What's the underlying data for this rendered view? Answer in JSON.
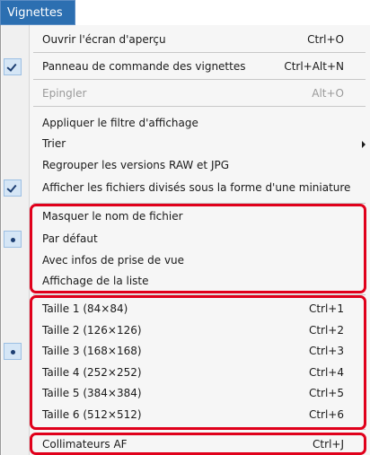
{
  "menu": {
    "title": "Vignettes",
    "items": [
      {
        "label": "Ouvrir l'écran d'aperçu",
        "shortcut": "Ctrl+O",
        "state": "none",
        "enabled": true
      },
      {
        "label": "Panneau de commande des vignettes",
        "shortcut": "Ctrl+Alt+N",
        "state": "checked",
        "enabled": true
      },
      {
        "label": "Epingler",
        "shortcut": "Alt+O",
        "state": "none",
        "enabled": false
      },
      {
        "label": "Appliquer le filtre d'affichage",
        "shortcut": "",
        "state": "none",
        "enabled": true
      },
      {
        "label": "Trier",
        "shortcut": "",
        "state": "none",
        "enabled": true,
        "submenu": true
      },
      {
        "label": "Regrouper les versions RAW et JPG",
        "shortcut": "",
        "state": "none",
        "enabled": true
      },
      {
        "label": "Afficher les fichiers divisés sous la forme d'une miniature",
        "shortcut": "",
        "state": "checked",
        "enabled": true
      },
      {
        "label": "Masquer le nom de fichier",
        "shortcut": "",
        "state": "none",
        "enabled": true
      },
      {
        "label": "Par défaut",
        "shortcut": "",
        "state": "radio",
        "enabled": true
      },
      {
        "label": "Avec infos de prise de vue",
        "shortcut": "",
        "state": "none",
        "enabled": true
      },
      {
        "label": "Affichage de la liste",
        "shortcut": "",
        "state": "none",
        "enabled": true
      },
      {
        "label": "Taille 1 (84×84)",
        "shortcut": "Ctrl+1",
        "state": "none",
        "enabled": true
      },
      {
        "label": "Taille 2 (126×126)",
        "shortcut": "Ctrl+2",
        "state": "none",
        "enabled": true
      },
      {
        "label": "Taille 3 (168×168)",
        "shortcut": "Ctrl+3",
        "state": "radio",
        "enabled": true
      },
      {
        "label": "Taille 4 (252×252)",
        "shortcut": "Ctrl+4",
        "state": "none",
        "enabled": true
      },
      {
        "label": "Taille 5 (384×384)",
        "shortcut": "Ctrl+5",
        "state": "none",
        "enabled": true
      },
      {
        "label": "Taille 6 (512×512)",
        "shortcut": "Ctrl+6",
        "state": "none",
        "enabled": true
      },
      {
        "label": "Collimateurs AF",
        "shortcut": "Ctrl+J",
        "state": "none",
        "enabled": true
      }
    ]
  },
  "colors": {
    "menu_title_bg": "#2c6fb1",
    "highlight_outline": "#e0001b",
    "disabled_text": "#9a9a9a"
  },
  "icons": {
    "checked": "checkmark-icon",
    "radio": "radio-dot-icon",
    "submenu": "submenu-arrow-icon"
  }
}
